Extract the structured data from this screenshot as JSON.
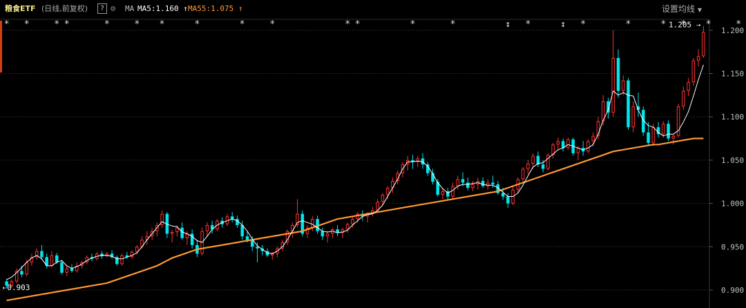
{
  "header": {
    "title": "粮食ETF",
    "subtitle": "(日线,前复权)",
    "help_icon_label": "?",
    "gear_icon": "gear-icon",
    "ma_label": "MA",
    "ma5_label": "MA5:1.160",
    "ma55_label": "MA55:1.075",
    "settings_label": "设置均线",
    "ma5_color": "#ffffff",
    "ma55_color": "#ff9933"
  },
  "chart_data": {
    "type": "candlestick",
    "x_axis": "trading days (unlabeled)",
    "ylim": [
      0.892,
      1.211
    ],
    "yticks": [
      "1.200",
      "1.150",
      "1.100",
      "1.050",
      "1.000",
      "0.950",
      "0.900"
    ],
    "grid": true,
    "up_color": "#ff3333",
    "down_color": "#00e5ee",
    "ohlc": [
      [
        0.91,
        0.913,
        0.903,
        0.905
      ],
      [
        0.905,
        0.912,
        0.903,
        0.91
      ],
      [
        0.91,
        0.925,
        0.908,
        0.922
      ],
      [
        0.922,
        0.928,
        0.915,
        0.918
      ],
      [
        0.918,
        0.935,
        0.916,
        0.932
      ],
      [
        0.932,
        0.942,
        0.928,
        0.938
      ],
      [
        0.938,
        0.948,
        0.935,
        0.945
      ],
      [
        0.945,
        0.952,
        0.935,
        0.938
      ],
      [
        0.938,
        0.942,
        0.925,
        0.928
      ],
      [
        0.928,
        0.945,
        0.926,
        0.94
      ],
      [
        0.94,
        0.943,
        0.93,
        0.932
      ],
      [
        0.932,
        0.935,
        0.918,
        0.92
      ],
      [
        0.92,
        0.928,
        0.916,
        0.925
      ],
      [
        0.925,
        0.93,
        0.92,
        0.922
      ],
      [
        0.922,
        0.932,
        0.92,
        0.928
      ],
      [
        0.928,
        0.934,
        0.925,
        0.932
      ],
      [
        0.932,
        0.94,
        0.93,
        0.938
      ],
      [
        0.938,
        0.942,
        0.933,
        0.936
      ],
      [
        0.936,
        0.944,
        0.934,
        0.942
      ],
      [
        0.942,
        0.945,
        0.936,
        0.939
      ],
      [
        0.939,
        0.944,
        0.938,
        0.942
      ],
      [
        0.942,
        0.946,
        0.936,
        0.938
      ],
      [
        0.938,
        0.94,
        0.928,
        0.93
      ],
      [
        0.93,
        0.942,
        0.928,
        0.94
      ],
      [
        0.94,
        0.944,
        0.936,
        0.938
      ],
      [
        0.938,
        0.946,
        0.936,
        0.944
      ],
      [
        0.944,
        0.952,
        0.941,
        0.95
      ],
      [
        0.95,
        0.962,
        0.948,
        0.958
      ],
      [
        0.958,
        0.968,
        0.952,
        0.962
      ],
      [
        0.962,
        0.972,
        0.958,
        0.968
      ],
      [
        0.968,
        0.978,
        0.962,
        0.975
      ],
      [
        0.975,
        0.992,
        0.972,
        0.988
      ],
      [
        0.988,
        0.99,
        0.96,
        0.965
      ],
      [
        0.965,
        0.97,
        0.955,
        0.967
      ],
      [
        0.967,
        0.975,
        0.962,
        0.972
      ],
      [
        0.972,
        0.978,
        0.958,
        0.96
      ],
      [
        0.96,
        0.968,
        0.952,
        0.965
      ],
      [
        0.965,
        0.97,
        0.948,
        0.952
      ],
      [
        0.952,
        0.958,
        0.938,
        0.942
      ],
      [
        0.942,
        0.972,
        0.94,
        0.968
      ],
      [
        0.968,
        0.978,
        0.962,
        0.975
      ],
      [
        0.975,
        0.98,
        0.965,
        0.97
      ],
      [
        0.97,
        0.982,
        0.968,
        0.98
      ],
      [
        0.98,
        0.984,
        0.972,
        0.976
      ],
      [
        0.976,
        0.988,
        0.974,
        0.985
      ],
      [
        0.985,
        0.99,
        0.978,
        0.982
      ],
      [
        0.982,
        0.986,
        0.972,
        0.975
      ],
      [
        0.975,
        0.98,
        0.958,
        0.962
      ],
      [
        0.962,
        0.968,
        0.955,
        0.958
      ],
      [
        0.958,
        0.962,
        0.945,
        0.95
      ],
      [
        0.95,
        0.955,
        0.932,
        0.948
      ],
      [
        0.948,
        0.952,
        0.94,
        0.945
      ],
      [
        0.945,
        0.948,
        0.938,
        0.94
      ],
      [
        0.94,
        0.944,
        0.935,
        0.942
      ],
      [
        0.942,
        0.95,
        0.938,
        0.948
      ],
      [
        0.948,
        0.958,
        0.945,
        0.955
      ],
      [
        0.955,
        0.97,
        0.952,
        0.968
      ],
      [
        0.968,
        0.978,
        0.96,
        0.975
      ],
      [
        0.975,
        1.005,
        0.972,
        0.988
      ],
      [
        0.988,
        0.992,
        0.962,
        0.965
      ],
      [
        0.965,
        0.975,
        0.96,
        0.972
      ],
      [
        0.972,
        0.985,
        0.968,
        0.982
      ],
      [
        0.982,
        0.986,
        0.965,
        0.968
      ],
      [
        0.968,
        0.972,
        0.958,
        0.962
      ],
      [
        0.962,
        0.968,
        0.955,
        0.965
      ],
      [
        0.965,
        0.972,
        0.96,
        0.97
      ],
      [
        0.97,
        0.975,
        0.962,
        0.966
      ],
      [
        0.966,
        0.972,
        0.96,
        0.97
      ],
      [
        0.97,
        0.978,
        0.966,
        0.976
      ],
      [
        0.976,
        0.985,
        0.972,
        0.982
      ],
      [
        0.982,
        0.99,
        0.978,
        0.988
      ],
      [
        0.988,
        0.992,
        0.98,
        0.985
      ],
      [
        0.985,
        0.99,
        0.978,
        0.988
      ],
      [
        0.988,
        0.996,
        0.985,
        0.992
      ],
      [
        0.992,
        1.005,
        0.99,
        1.002
      ],
      [
        1.002,
        1.012,
        0.998,
        1.01
      ],
      [
        1.01,
        1.02,
        1.005,
        1.018
      ],
      [
        1.018,
        1.03,
        1.012,
        1.026
      ],
      [
        1.026,
        1.038,
        1.022,
        1.035
      ],
      [
        1.035,
        1.048,
        1.03,
        1.045
      ],
      [
        1.045,
        1.055,
        1.038,
        1.05
      ],
      [
        1.05,
        1.056,
        1.04,
        1.048
      ],
      [
        1.048,
        1.055,
        1.042,
        1.052
      ],
      [
        1.052,
        1.058,
        1.04,
        1.045
      ],
      [
        1.045,
        1.048,
        1.032,
        1.035
      ],
      [
        1.035,
        1.04,
        1.022,
        1.025
      ],
      [
        1.025,
        1.028,
        1.008,
        1.01
      ],
      [
        1.01,
        1.018,
        1.005,
        1.014
      ],
      [
        1.014,
        1.018,
        1.004,
        1.008
      ],
      [
        1.008,
        1.024,
        1.004,
        1.02
      ],
      [
        1.02,
        1.032,
        1.016,
        1.028
      ],
      [
        1.028,
        1.036,
        1.02,
        1.024
      ],
      [
        1.024,
        1.03,
        1.015,
        1.018
      ],
      [
        1.018,
        1.026,
        1.014,
        1.022
      ],
      [
        1.022,
        1.03,
        1.016,
        1.026
      ],
      [
        1.026,
        1.03,
        1.018,
        1.02
      ],
      [
        1.02,
        1.028,
        1.016,
        1.024
      ],
      [
        1.024,
        1.032,
        1.018,
        1.022
      ],
      [
        1.022,
        1.026,
        1.01,
        1.012
      ],
      [
        1.012,
        1.018,
        1.004,
        1.008
      ],
      [
        1.008,
        1.012,
        0.995,
        1.0
      ],
      [
        1.0,
        1.02,
        0.998,
        1.016
      ],
      [
        1.016,
        1.03,
        1.012,
        1.028
      ],
      [
        1.028,
        1.042,
        1.024,
        1.04
      ],
      [
        1.04,
        1.05,
        1.034,
        1.046
      ],
      [
        1.046,
        1.058,
        1.04,
        1.055
      ],
      [
        1.055,
        1.06,
        1.042,
        1.045
      ],
      [
        1.045,
        1.05,
        1.036,
        1.04
      ],
      [
        1.04,
        1.058,
        1.038,
        1.056
      ],
      [
        1.056,
        1.07,
        1.052,
        1.068
      ],
      [
        1.068,
        1.076,
        1.062,
        1.072
      ],
      [
        1.072,
        1.075,
        1.06,
        1.064
      ],
      [
        1.064,
        1.076,
        1.062,
        1.074
      ],
      [
        1.074,
        1.076,
        1.055,
        1.058
      ],
      [
        1.058,
        1.066,
        1.05,
        1.064
      ],
      [
        1.064,
        1.072,
        1.055,
        1.06
      ],
      [
        1.06,
        1.074,
        1.058,
        1.072
      ],
      [
        1.072,
        1.082,
        1.066,
        1.078
      ],
      [
        1.078,
        1.1,
        1.074,
        1.095
      ],
      [
        1.095,
        1.125,
        1.09,
        1.118
      ],
      [
        1.118,
        1.122,
        1.098,
        1.105
      ],
      [
        1.105,
        1.2,
        1.1,
        1.168
      ],
      [
        1.168,
        1.178,
        1.122,
        1.13
      ],
      [
        1.13,
        1.148,
        1.125,
        1.142
      ],
      [
        1.142,
        1.145,
        1.085,
        1.088
      ],
      [
        1.088,
        1.118,
        1.082,
        1.112
      ],
      [
        1.112,
        1.128,
        1.1,
        1.108
      ],
      [
        1.108,
        1.112,
        1.078,
        1.082
      ],
      [
        1.082,
        1.094,
        1.066,
        1.07
      ],
      [
        1.07,
        1.092,
        1.066,
        1.088
      ],
      [
        1.088,
        1.094,
        1.076,
        1.08
      ],
      [
        1.08,
        1.095,
        1.076,
        1.092
      ],
      [
        1.092,
        1.096,
        1.072,
        1.075
      ],
      [
        1.075,
        1.08,
        1.068,
        1.078
      ],
      [
        1.078,
        1.115,
        1.076,
        1.112
      ],
      [
        1.112,
        1.135,
        1.108,
        1.13
      ],
      [
        1.13,
        1.145,
        1.124,
        1.14
      ],
      [
        1.14,
        1.168,
        1.136,
        1.165
      ],
      [
        1.165,
        1.178,
        1.158,
        1.17
      ],
      [
        1.17,
        1.205,
        1.168,
        1.198
      ]
    ],
    "ma5": {
      "name": "MA5",
      "values": [
        0.912,
        0.915,
        0.92,
        0.926,
        0.932,
        0.937,
        0.94,
        0.936,
        0.928,
        0.928,
        0.932,
        0.934,
        0.928,
        0.925,
        0.927,
        0.93,
        0.934,
        0.937,
        0.939,
        0.94,
        0.94,
        0.939,
        0.936,
        0.936,
        0.938,
        0.94,
        0.943,
        0.95,
        0.958,
        0.965,
        0.972,
        0.979,
        0.976,
        0.974,
        0.973,
        0.967,
        0.965,
        0.962,
        0.957,
        0.955,
        0.962,
        0.97,
        0.975,
        0.978,
        0.98,
        0.982,
        0.98,
        0.975,
        0.968,
        0.959,
        0.951,
        0.947,
        0.943,
        0.942,
        0.945,
        0.95,
        0.958,
        0.968,
        0.978,
        0.98,
        0.978,
        0.976,
        0.972,
        0.968,
        0.967,
        0.968,
        0.966,
        0.967,
        0.969,
        0.975,
        0.98,
        0.985,
        0.987,
        0.988,
        0.992,
        0.998,
        1.008,
        1.018,
        1.028,
        1.04,
        1.048,
        1.048,
        1.049,
        1.048,
        1.043,
        1.034,
        1.024,
        1.017,
        1.012,
        1.015,
        1.02,
        1.022,
        1.022,
        1.023,
        1.024,
        1.022,
        1.021,
        1.021,
        1.018,
        1.013,
        1.008,
        1.008,
        1.012,
        1.021,
        1.032,
        1.042,
        1.046,
        1.047,
        1.052,
        1.057,
        1.062,
        1.064,
        1.068,
        1.066,
        1.064,
        1.062,
        1.064,
        1.068,
        1.08,
        1.096,
        1.108,
        1.13,
        1.125,
        1.128,
        1.125,
        1.124,
        1.108,
        1.096,
        1.09,
        1.088,
        1.082,
        1.078,
        1.08,
        1.08,
        1.084,
        1.094,
        1.106,
        1.124,
        1.143,
        1.16
      ]
    },
    "ma55": {
      "name": "MA55",
      "values": [
        0.888,
        0.889,
        0.89,
        0.891,
        0.892,
        0.893,
        0.894,
        0.895,
        0.896,
        0.897,
        0.898,
        0.899,
        0.9,
        0.901,
        0.902,
        0.903,
        0.904,
        0.905,
        0.906,
        0.907,
        0.908,
        0.91,
        0.912,
        0.914,
        0.916,
        0.918,
        0.92,
        0.922,
        0.924,
        0.926,
        0.928,
        0.931,
        0.934,
        0.937,
        0.939,
        0.941,
        0.943,
        0.945,
        0.947,
        0.948,
        0.949,
        0.95,
        0.951,
        0.952,
        0.953,
        0.954,
        0.955,
        0.956,
        0.957,
        0.958,
        0.959,
        0.96,
        0.961,
        0.962,
        0.963,
        0.964,
        0.965,
        0.966,
        0.967,
        0.968,
        0.97,
        0.972,
        0.974,
        0.976,
        0.978,
        0.98,
        0.982,
        0.983,
        0.984,
        0.985,
        0.986,
        0.987,
        0.988,
        0.989,
        0.99,
        0.991,
        0.992,
        0.993,
        0.994,
        0.995,
        0.996,
        0.997,
        0.998,
        0.999,
        1.0,
        1.001,
        1.002,
        1.003,
        1.004,
        1.005,
        1.006,
        1.007,
        1.008,
        1.009,
        1.01,
        1.011,
        1.012,
        1.013,
        1.014,
        1.016,
        1.018,
        1.02,
        1.022,
        1.024,
        1.026,
        1.028,
        1.03,
        1.032,
        1.034,
        1.036,
        1.038,
        1.04,
        1.042,
        1.044,
        1.046,
        1.048,
        1.05,
        1.052,
        1.054,
        1.056,
        1.058,
        1.06,
        1.061,
        1.062,
        1.063,
        1.064,
        1.065,
        1.066,
        1.067,
        1.068,
        1.068,
        1.069,
        1.07,
        1.071,
        1.072,
        1.073,
        1.074,
        1.075,
        1.075,
        1.075
      ]
    },
    "high_marker": {
      "label": "1.205",
      "arrow": "⇢"
    },
    "low_marker": {
      "label": "0.903",
      "arrow": "⇠"
    },
    "event_markers": [
      {
        "index": 0,
        "symbol": "*"
      },
      {
        "index": 4,
        "symbol": "*"
      },
      {
        "index": 10,
        "symbol": "*"
      },
      {
        "index": 12,
        "symbol": "*"
      },
      {
        "index": 20,
        "symbol": "*"
      },
      {
        "index": 26,
        "symbol": "*"
      },
      {
        "index": 31,
        "symbol": "*"
      },
      {
        "index": 38,
        "symbol": "*"
      },
      {
        "index": 47,
        "symbol": "*"
      },
      {
        "index": 53,
        "symbol": "*"
      },
      {
        "index": 68,
        "symbol": "*"
      },
      {
        "index": 70,
        "symbol": "*"
      },
      {
        "index": 81,
        "symbol": "*"
      },
      {
        "index": 89,
        "symbol": "*"
      },
      {
        "index": 100,
        "symbol": "↕"
      },
      {
        "index": 104,
        "symbol": "*"
      },
      {
        "index": 111,
        "symbol": "↕"
      },
      {
        "index": 115,
        "symbol": "*"
      },
      {
        "index": 124,
        "symbol": "*"
      },
      {
        "index": 131,
        "symbol": "*"
      },
      {
        "index": 135,
        "symbol": "*"
      },
      {
        "index": 140,
        "symbol": "*"
      },
      {
        "index": 146,
        "symbol": "*"
      },
      {
        "index": 150,
        "symbol": "*"
      },
      {
        "index": 158,
        "symbol": "*"
      }
    ]
  }
}
